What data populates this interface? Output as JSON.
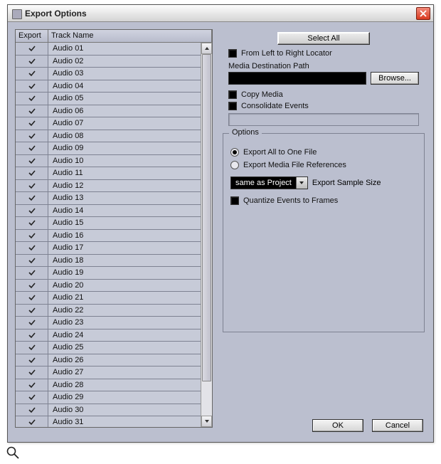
{
  "window": {
    "title": "Export Options",
    "close_icon": "×"
  },
  "table": {
    "header_export": "Export",
    "header_name": "Track Name",
    "rows": [
      {
        "checked": true,
        "name": "Audio 01"
      },
      {
        "checked": true,
        "name": "Audio 02"
      },
      {
        "checked": true,
        "name": "Audio 03"
      },
      {
        "checked": true,
        "name": "Audio 04"
      },
      {
        "checked": true,
        "name": "Audio 05"
      },
      {
        "checked": true,
        "name": "Audio 06"
      },
      {
        "checked": true,
        "name": "Audio 07"
      },
      {
        "checked": true,
        "name": "Audio 08"
      },
      {
        "checked": true,
        "name": "Audio 09"
      },
      {
        "checked": true,
        "name": "Audio 10"
      },
      {
        "checked": true,
        "name": "Audio 11"
      },
      {
        "checked": true,
        "name": "Audio 12"
      },
      {
        "checked": true,
        "name": "Audio 13"
      },
      {
        "checked": true,
        "name": "Audio 14"
      },
      {
        "checked": true,
        "name": "Audio 15"
      },
      {
        "checked": true,
        "name": "Audio 16"
      },
      {
        "checked": true,
        "name": "Audio 17"
      },
      {
        "checked": true,
        "name": "Audio 18"
      },
      {
        "checked": true,
        "name": "Audio 19"
      },
      {
        "checked": true,
        "name": "Audio 20"
      },
      {
        "checked": true,
        "name": "Audio 21"
      },
      {
        "checked": true,
        "name": "Audio 22"
      },
      {
        "checked": true,
        "name": "Audio 23"
      },
      {
        "checked": true,
        "name": "Audio 24"
      },
      {
        "checked": true,
        "name": "Audio 25"
      },
      {
        "checked": true,
        "name": "Audio 26"
      },
      {
        "checked": true,
        "name": "Audio 27"
      },
      {
        "checked": true,
        "name": "Audio 28"
      },
      {
        "checked": true,
        "name": "Audio 29"
      },
      {
        "checked": true,
        "name": "Audio 30"
      },
      {
        "checked": true,
        "name": "Audio 31"
      }
    ]
  },
  "controls": {
    "select_all": "Select All",
    "left_right_label": "From Left to Right Locator",
    "media_dest_label": "Media Destination Path",
    "media_dest_value": "",
    "browse": "Browse...",
    "copy_media_label": "Copy Media",
    "consolidate_label": "Consolidate Events",
    "consolidate_value": ""
  },
  "options": {
    "group_title": "Options",
    "export_all_label": "Export All to One File",
    "export_refs_label": "Export Media File References",
    "selected_radio": "export_all",
    "sample_size_value": "same as Project",
    "sample_size_label": "Export Sample Size",
    "quantize_label": "Quantize Events to Frames"
  },
  "buttons": {
    "ok": "OK",
    "cancel": "Cancel"
  }
}
